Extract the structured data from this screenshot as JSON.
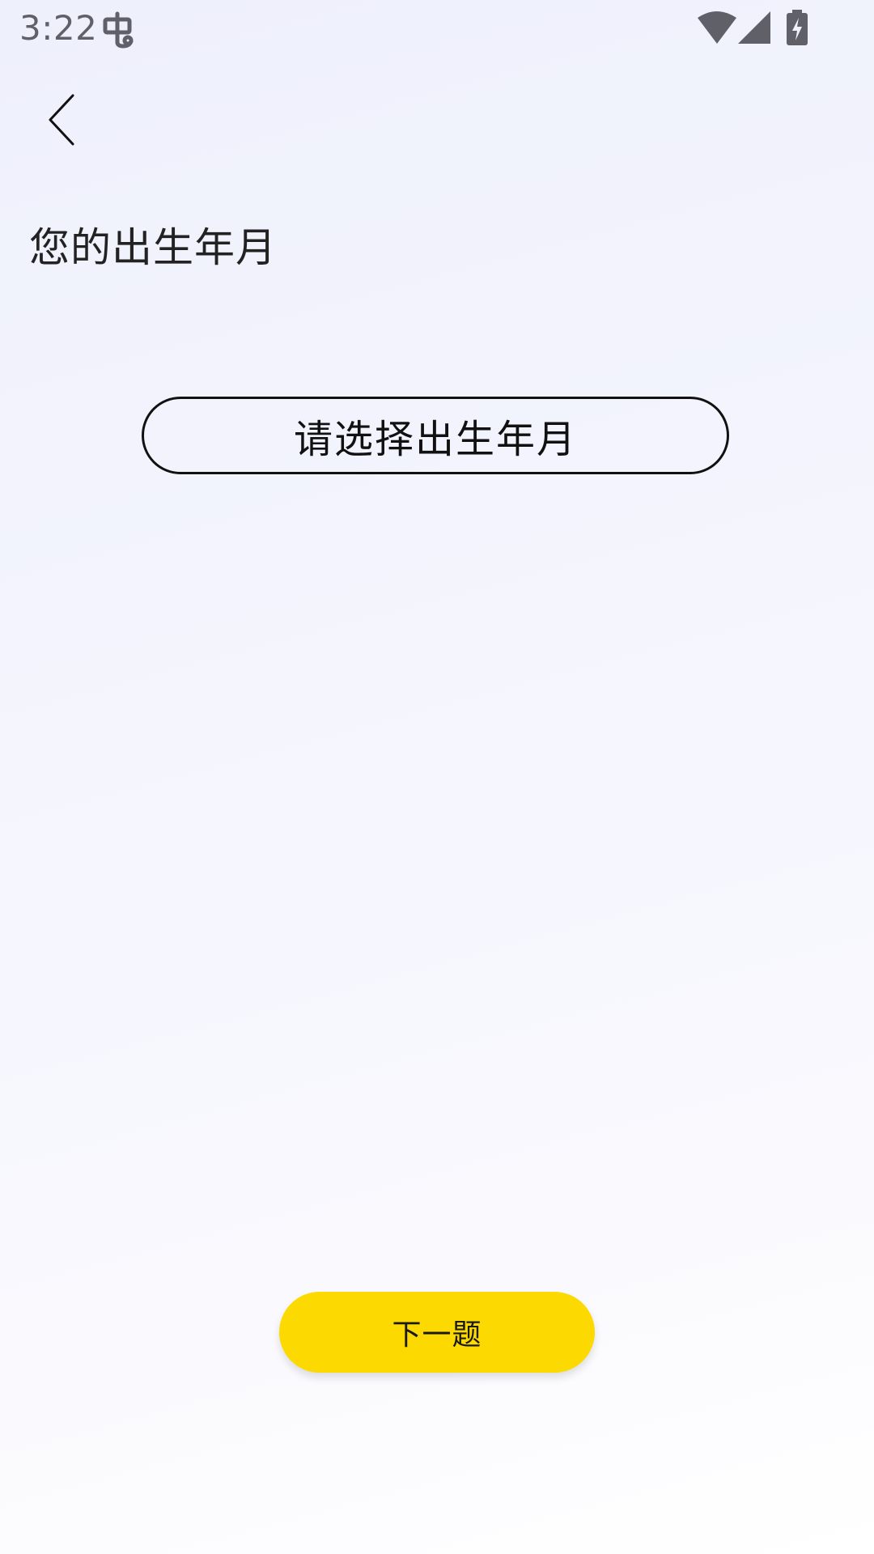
{
  "status_bar": {
    "time": "3:22",
    "icons": [
      "bug-icon",
      "wifi-icon",
      "signal-icon",
      "battery-charging-icon"
    ]
  },
  "navigation": {
    "back_icon": "chevron-left-icon"
  },
  "question": {
    "title": "您的出生年月"
  },
  "date_selector": {
    "placeholder": "请选择出生年月"
  },
  "footer": {
    "next_label": "下一题"
  },
  "colors": {
    "accent": "#fcd900",
    "text": "#111111",
    "status_icons": "#5f6068",
    "background_top": "#eef0fc",
    "background_bottom": "#ffffff"
  }
}
